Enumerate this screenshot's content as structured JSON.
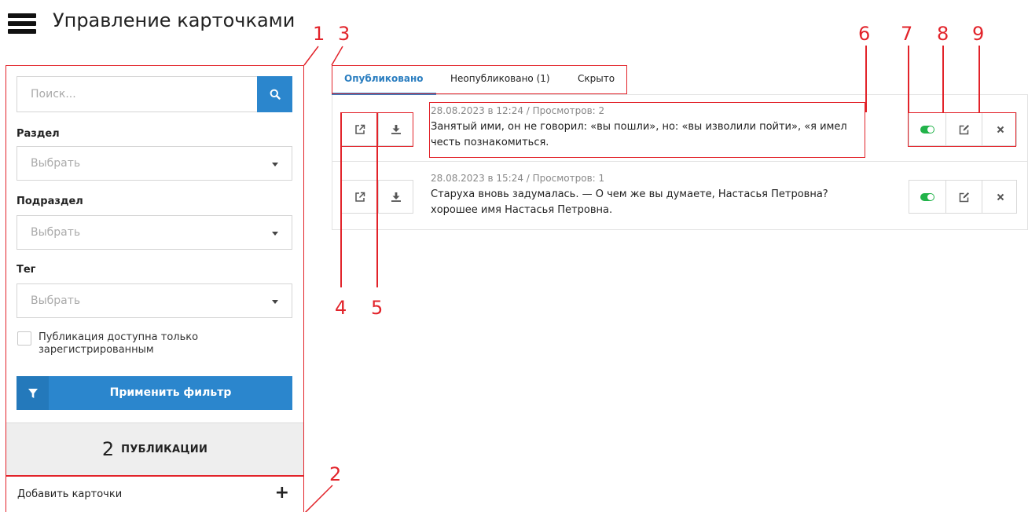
{
  "header": {
    "title": "Управление карточками",
    "menu_icon": "hamburger-icon"
  },
  "sidebar": {
    "search": {
      "placeholder": "Поиск...",
      "value": "",
      "icon": "search-icon"
    },
    "filters": [
      {
        "label": "Раздел",
        "value": "Выбрать"
      },
      {
        "label": "Подраздел",
        "value": "Выбрать"
      },
      {
        "label": "Тег",
        "value": "Выбрать"
      }
    ],
    "checkbox": {
      "label": "Публикация доступна только зарегистрированным",
      "checked": false
    },
    "apply_button": {
      "label": "Применить фильтр",
      "icon": "filter-icon"
    },
    "count": {
      "number": "2",
      "label": "ПУБЛИКАЦИИ"
    },
    "add": {
      "label": "Добавить карточки",
      "icon": "plus-icon"
    }
  },
  "tabs": [
    {
      "label": "Опубликовано",
      "active": true
    },
    {
      "label": "Неопубликовано (1)",
      "active": false
    },
    {
      "label": "Скрыто",
      "active": false
    }
  ],
  "publications": [
    {
      "meta": "28.08.2023 в 12:24 / Просмотров: 2",
      "text": "Занятый ими, он не говорил: «вы пошли», но: «вы изволили пойти», «я имел честь познакомиться.",
      "published": true
    },
    {
      "meta": "28.08.2023 в 15:24 / Просмотров: 1",
      "text": "Старуха вновь задумалась. — О чем же вы думаете, Настасья Петровна? хорошее имя Настасья Петровна.",
      "published": true
    }
  ],
  "row_icons": [
    "external-link-icon",
    "download-icon",
    "toggle-icon",
    "edit-icon",
    "close-icon"
  ],
  "annotations": [
    "1",
    "2",
    "3",
    "4",
    "5",
    "6",
    "7",
    "8",
    "9"
  ],
  "colors": {
    "accent": "#2b86cd",
    "active_tab": "#2b7ec0",
    "toggle_on": "#22b34a",
    "annotation": "#e2232a"
  }
}
